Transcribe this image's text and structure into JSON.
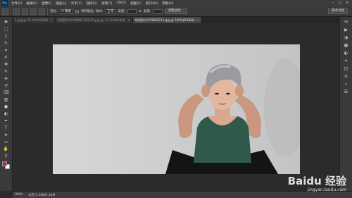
{
  "menubar": {
    "logo": "Ps",
    "items": [
      "文件(F)",
      "编辑(E)",
      "图像(I)",
      "图层(L)",
      "文字(Y)",
      "选择(S)",
      "滤镜(T)",
      "3D(D)",
      "视图(V)",
      "窗口(W)",
      "帮助(H)"
    ],
    "window_controls": [
      "–",
      "□",
      "×"
    ]
  },
  "options": {
    "feather_label": "羽化:",
    "feather_value": "0 像素",
    "antialias_label": "消除锯齿",
    "style_label": "样式:",
    "style_value": "正常",
    "width_label": "宽度:",
    "height_label": "高度:",
    "refine_edge": "调整边缘...",
    "workspace": "基本功能"
  },
  "tabs": [
    {
      "label": "1.jpg @ 33.3%(RGB/8)",
      "active": false
    },
    {
      "label": "QQ图片20190902120335.jpg @ 33.3%(RGB/8)",
      "active": false
    },
    {
      "label": "QQ图片2019090212.jpg @ 100%(RGB/8)",
      "active": true
    }
  ],
  "toolbox": {
    "icons": [
      "move-icon",
      "marquee-icon",
      "lasso-icon",
      "quick-select-icon",
      "crop-icon",
      "eyedropper-icon",
      "healing-icon",
      "brush-icon",
      "clone-stamp-icon",
      "history-brush-icon",
      "eraser-icon",
      "gradient-icon",
      "blur-icon",
      "dodge-icon",
      "pen-icon",
      "type-icon",
      "path-select-icon",
      "shape-icon",
      "hand-icon",
      "zoom-icon"
    ],
    "glyphs": [
      "✥",
      "⬚",
      "ℓ",
      "✎",
      "⌗",
      "✐",
      "✚",
      "✎",
      "⎈",
      "↺",
      "⌫",
      "▥",
      "●",
      "◐",
      "✒",
      "T",
      "➤",
      "▭",
      "✋",
      "⚲"
    ],
    "foreground_color": "#c9252c",
    "background_color": "#ffffff"
  },
  "rightdock": {
    "icons": [
      "history-icon",
      "actions-icon",
      "color-icon",
      "swatches-icon",
      "adjustments-icon",
      "styles-icon",
      "layers-icon",
      "channels-icon",
      "paths-icon",
      "properties-icon"
    ],
    "glyphs": [
      "⟲",
      "▶",
      "◑",
      "▦",
      "◐",
      "✦",
      "◫",
      "≋",
      "⌁",
      "☰"
    ]
  },
  "status": {
    "zoom": "100%",
    "doc_size": "文档:1.24M/1.24M"
  },
  "watermark": {
    "logo": "Baidu 经验",
    "url": "jingyan.baidu.com"
  }
}
